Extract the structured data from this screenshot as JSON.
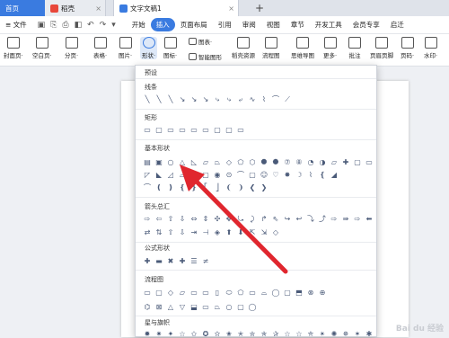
{
  "tabs": {
    "home": "首页",
    "daoke": "稻壳",
    "doc": "文字文稿1",
    "plus": "+"
  },
  "menu": {
    "file": "≡ 文件",
    "items": [
      "开始",
      "插入",
      "页面布局",
      "引用",
      "审阅",
      "视图",
      "章节",
      "开发工具",
      "会员专享",
      "启迁"
    ],
    "active_index": 1
  },
  "ribbon": {
    "buttons": [
      "封面页·",
      "空白页·",
      "分页·",
      "表格·",
      "图片·",
      "形状·",
      "图标·",
      "图表·",
      "智能图形",
      "稻壳资源",
      "流程图",
      "思维导图",
      "更多·",
      "批注",
      "页眉页脚",
      "页码·",
      "水印·"
    ]
  },
  "panel": {
    "preset": "预设",
    "sections": [
      "线条",
      "矩形",
      "基本形状",
      "箭头总汇",
      "公式形状",
      "流程图",
      "星与旗帜"
    ]
  },
  "watermark": "Bai du 经验",
  "colors": {
    "accent": "#3a7be0",
    "arrow": "#e0262e"
  }
}
